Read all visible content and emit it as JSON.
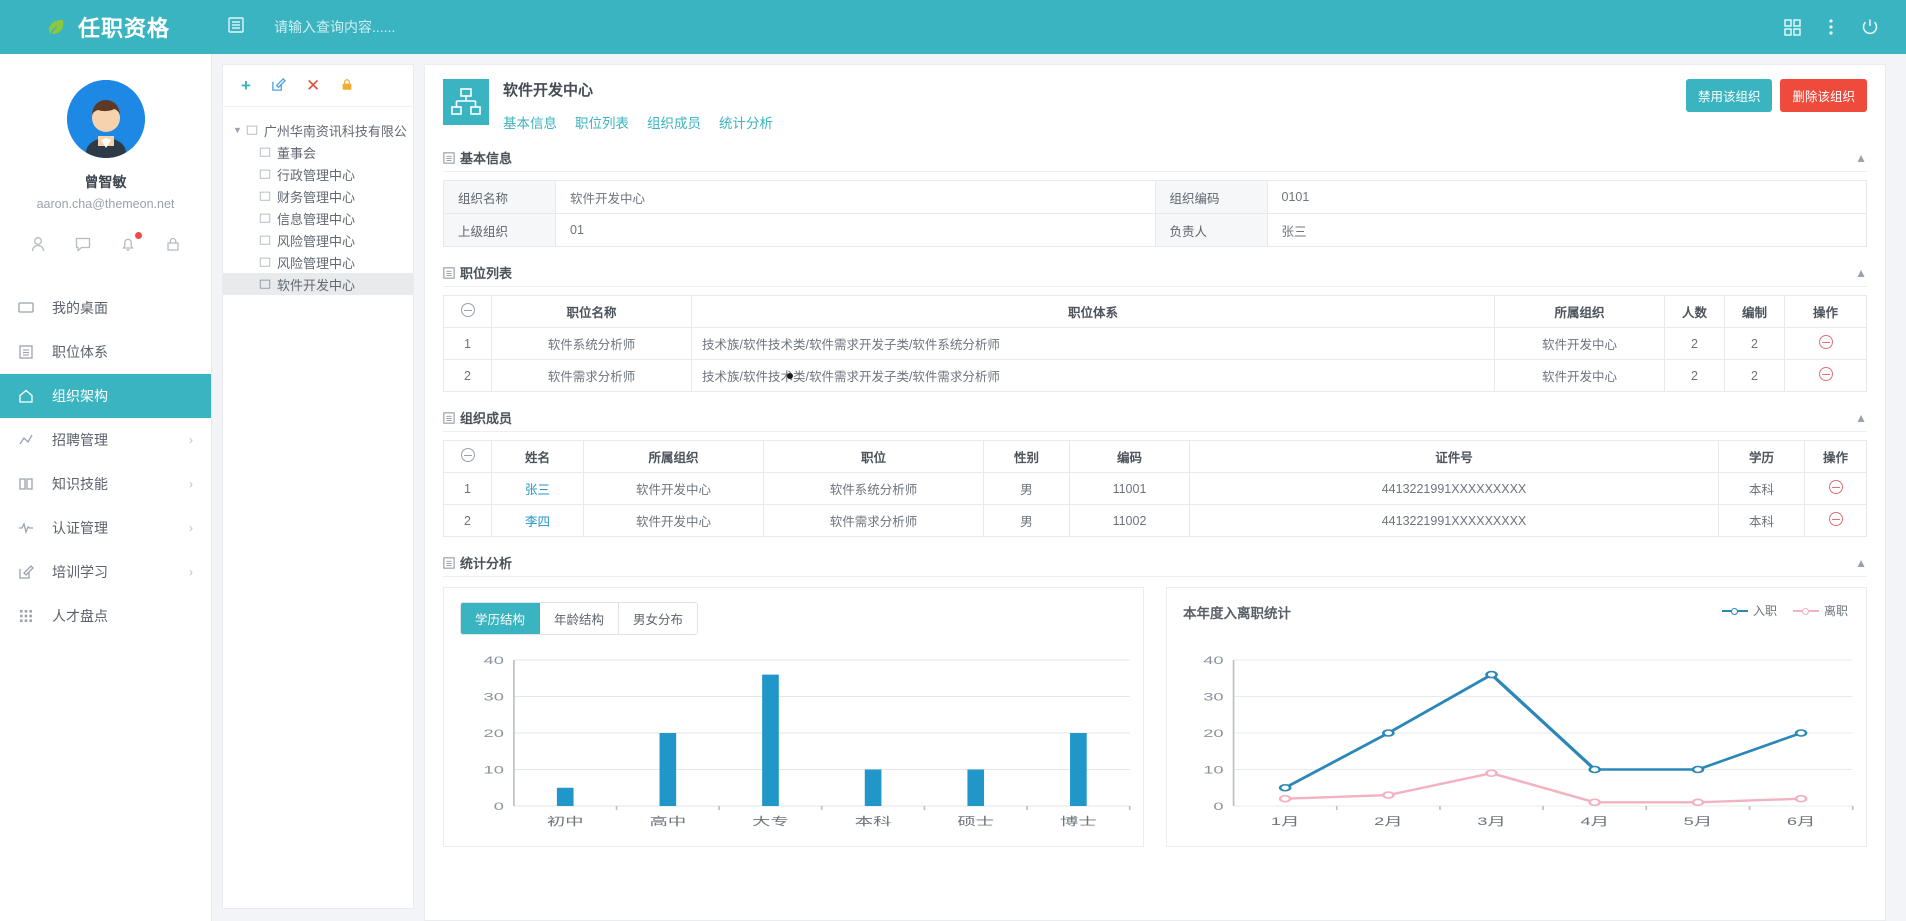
{
  "topbar": {
    "brand_title": "任职资格",
    "logo_icon": "leaf-icon",
    "menu_icon": "list-menu-icon",
    "search_placeholder": "请输入查询内容......",
    "search_value": "",
    "right_icons": [
      "apps-grid-icon",
      "more-vertical-icon",
      "power-icon"
    ]
  },
  "sidebar": {
    "user_name": "曾智敏",
    "user_email": "aaron.cha@themeon.net",
    "quick_icons": [
      "user-icon",
      "message-icon",
      "bell-icon",
      "lock-icon"
    ],
    "nav": [
      {
        "label": "我的桌面",
        "icon": "monitor-icon",
        "active": false,
        "caret": false
      },
      {
        "label": "职位体系",
        "icon": "list-doc-icon",
        "active": false,
        "caret": false
      },
      {
        "label": "组织架构",
        "icon": "home-icon",
        "active": true,
        "caret": false
      },
      {
        "label": "招聘管理",
        "icon": "chart-bars-icon",
        "active": false,
        "caret": true
      },
      {
        "label": "知识技能",
        "icon": "book-icon",
        "active": false,
        "caret": true
      },
      {
        "label": "认证管理",
        "icon": "pulse-icon",
        "active": false,
        "caret": true
      },
      {
        "label": "培训学习",
        "icon": "edit-square-icon",
        "active": false,
        "caret": true
      },
      {
        "label": "人才盘点",
        "icon": "grid-dots-icon",
        "active": false,
        "caret": false
      }
    ]
  },
  "tree_panel": {
    "tools": [
      {
        "name": "add",
        "glyph": "+"
      },
      {
        "name": "edit",
        "glyph": "✎"
      },
      {
        "name": "delete",
        "glyph": "✕"
      },
      {
        "name": "lock",
        "glyph": "🔒"
      }
    ],
    "nodes": [
      {
        "label": "广州华南资讯科技有限公",
        "level": 0,
        "selected": false
      },
      {
        "label": "董事会",
        "level": 1,
        "selected": false
      },
      {
        "label": "行政管理中心",
        "level": 1,
        "selected": false
      },
      {
        "label": "财务管理中心",
        "level": 1,
        "selected": false
      },
      {
        "label": "信息管理中心",
        "level": 1,
        "selected": false
      },
      {
        "label": "风险管理中心",
        "level": 1,
        "selected": false
      },
      {
        "label": "风险管理中心",
        "level": 1,
        "selected": false
      },
      {
        "label": "软件开发中心",
        "level": 1,
        "selected": true
      }
    ]
  },
  "main": {
    "org_title": "软件开发中心",
    "org_icon": "org-chart-icon",
    "tabs": [
      {
        "label": "基本信息"
      },
      {
        "label": "职位列表"
      },
      {
        "label": "组织成员"
      },
      {
        "label": "统计分析"
      }
    ],
    "header_buttons": {
      "disable": "禁用该组织",
      "delete": "删除该组织"
    },
    "basic_info": {
      "section_title": "基本信息",
      "rows": [
        {
          "l1": "组织名称",
          "v1": "软件开发中心",
          "l2": "组织编码",
          "v2": "0101"
        },
        {
          "l1": "上级组织",
          "v1": "01",
          "l2": "负责人",
          "v2": "张三"
        }
      ]
    },
    "position_list": {
      "section_title": "职位列表",
      "headers": [
        "",
        "职位名称",
        "职位体系",
        "所属组织",
        "人数",
        "编制",
        "操作"
      ],
      "rows": [
        {
          "no": "1",
          "name": "软件系统分析师",
          "system": "技术族/软件技术类/软件需求开发子类/软件系统分析师",
          "org": "软件开发中心",
          "count": "2",
          "quota": "2"
        },
        {
          "no": "2",
          "name": "软件需求分析师",
          "system": "技术族/软件技术类/软件需求开发子类/软件需求分析师",
          "org": "软件开发中心",
          "count": "2",
          "quota": "2"
        }
      ]
    },
    "members": {
      "section_title": "组织成员",
      "headers": [
        "",
        "姓名",
        "所属组织",
        "职位",
        "性别",
        "编码",
        "证件号",
        "学历",
        "操作"
      ],
      "rows": [
        {
          "no": "1",
          "name": "张三",
          "org": "软件开发中心",
          "position": "软件系统分析师",
          "gender": "男",
          "code": "11001",
          "id_no": "4413221991XXXXXXXXX",
          "education": "本科"
        },
        {
          "no": "2",
          "name": "李四",
          "org": "软件开发中心",
          "position": "软件需求分析师",
          "gender": "男",
          "code": "11002",
          "id_no": "4413221991XXXXXXXXX",
          "education": "本科"
        }
      ]
    },
    "stats": {
      "section_title": "统计分析",
      "segments": [
        {
          "label": "学历结构",
          "active": true
        },
        {
          "label": "年龄结构",
          "active": false
        },
        {
          "label": "男女分布",
          "active": false
        }
      ]
    }
  },
  "chart_data": [
    {
      "type": "bar",
      "title": "",
      "categories": [
        "初中",
        "高中",
        "大专",
        "本科",
        "硕士",
        "博士"
      ],
      "values": [
        5,
        20,
        36,
        10,
        10,
        20
      ],
      "yticks": [
        0,
        10,
        20,
        30,
        40
      ],
      "ylim": [
        0,
        40
      ],
      "xlabel": "",
      "ylabel": "",
      "grid": true,
      "bar_color": "#2196c9"
    },
    {
      "type": "line",
      "title": "本年度入离职统计",
      "categories": [
        "1月",
        "2月",
        "3月",
        "4月",
        "5月",
        "6月"
      ],
      "series": [
        {
          "name": "入职",
          "values": [
            5,
            20,
            36,
            10,
            10,
            20
          ],
          "color": "#2b87b8"
        },
        {
          "name": "离职",
          "values": [
            2,
            3,
            9,
            1,
            1,
            2
          ],
          "color": "#f3b2c0"
        }
      ],
      "yticks": [
        0,
        10,
        20,
        30,
        40
      ],
      "ylim": [
        0,
        40
      ],
      "xlabel": "",
      "ylabel": "",
      "grid": true,
      "legend_position": "top-right"
    }
  ],
  "colors": {
    "accent": "#3bb4c1",
    "danger": "#ef4b3d",
    "bar": "#2196c9",
    "line_in": "#2b87b8",
    "line_out": "#f3b2c0"
  }
}
